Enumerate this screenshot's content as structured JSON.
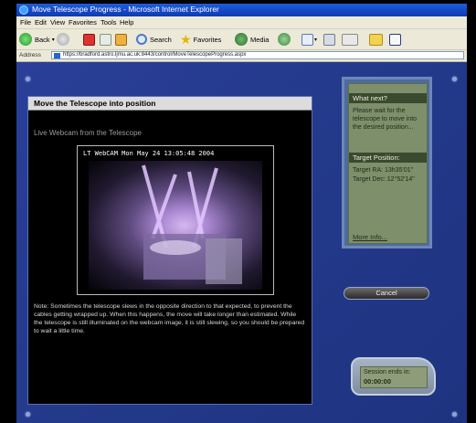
{
  "window": {
    "title": "Move Telescope Progress - Microsoft Internet Explorer"
  },
  "menu": [
    "File",
    "Edit",
    "View",
    "Favorites",
    "Tools",
    "Help"
  ],
  "toolbar": {
    "back": "Back",
    "search": "Search",
    "favorites": "Favorites",
    "media": "Media"
  },
  "address": {
    "label": "Address",
    "url": "https://bradford.astro.ljmu.ac.uk:8443/control/MoveTelescopeProgress.aspx"
  },
  "main": {
    "header": "Move the Telescope into position",
    "webcam_label": "Live Webcam from the Telescope",
    "cam_stamp": "LT WebCAM  Mon May 24  13:05:48  2004",
    "note": "Note: Sometimes the telescope slews in the opposite direction to that expected, to prevent the cables getting wrapped up. When this happens, the move will take longer than estimated. While the telescope is still illuminated on the webcam image, it is still slewing, so you should be prepared to wait a little time."
  },
  "side": {
    "what_next_title": "What next?",
    "what_next_text": "Please wait for the telescope to move into the desired position...",
    "target_title": "Target Position:",
    "target_ra": "Target RA: 13h35'01\"",
    "target_dec": "Target Dec: 12°52'14\"",
    "more_info": "More Info..."
  },
  "cancel_label": "Cancel",
  "session": {
    "line1": "Session ends in:",
    "time": "00:00:00"
  }
}
